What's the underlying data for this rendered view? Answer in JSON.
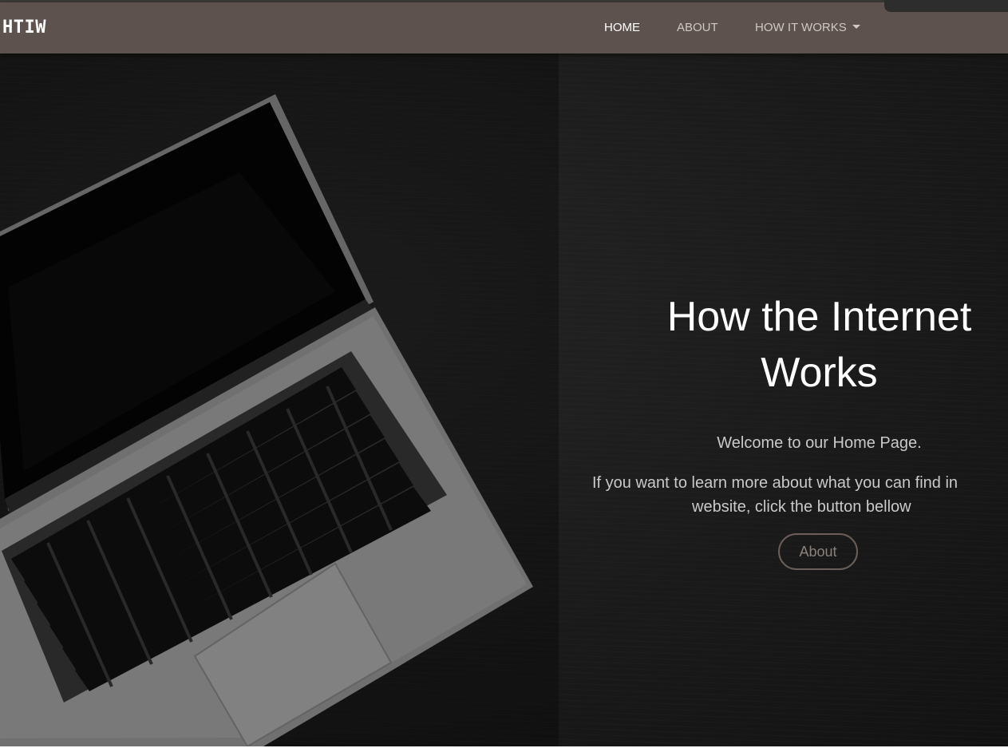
{
  "navbar": {
    "brand": "HTIW",
    "links": [
      {
        "label": "HOME",
        "active": true
      },
      {
        "label": "ABOUT",
        "active": false
      },
      {
        "label": "HOW IT WORKS",
        "active": false,
        "dropdown": true
      }
    ]
  },
  "hero": {
    "title": "How the Internet Works",
    "welcome": "Welcome to our Home Page.",
    "description_line1": "If you want to learn more about what you can find in",
    "description_line2": "website, click the button bellow",
    "button_label": "About"
  },
  "colors": {
    "navbar_bg": "#5d524d",
    "hero_bg": "#1b1b1b",
    "button_border": "#6b5f59",
    "text_light": "#c9c9c9"
  },
  "icons": {
    "dropdown": "caret-down-icon"
  }
}
